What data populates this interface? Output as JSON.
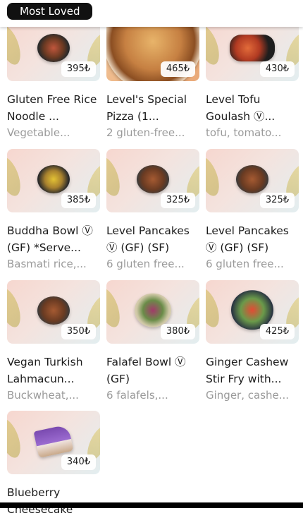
{
  "header": {
    "section_title": "Most Loved"
  },
  "items": [
    {
      "name": "Gluten Free Rice Noodle ...",
      "desc": "Vegetable...",
      "price": "395₺",
      "icon": "noodle-dish"
    },
    {
      "name": "Level's Special Pizza (1...",
      "desc": "2 gluten-free...",
      "price": "465₺",
      "icon": "pizza"
    },
    {
      "name": "Level Tofu Goulash Ⓥ...",
      "desc": "tofu, tomato...",
      "price": "430₺",
      "icon": "sizzling-pan"
    },
    {
      "name": "Buddha Bowl Ⓥ (GF) *Serve...",
      "desc": "Basmati rice,...",
      "price": "385₺",
      "icon": "bowl"
    },
    {
      "name": "Level Pancakes Ⓥ (GF) (SF)",
      "desc": "6 gluten free...",
      "price": "325₺",
      "icon": "pancakes"
    },
    {
      "name": "Level Pancakes Ⓥ (GF) (SF)",
      "desc": "6 gluten free...",
      "price": "325₺",
      "icon": "pancakes"
    },
    {
      "name": "Vegan Turkish Lahmacun...",
      "desc": "Buckwheat,...",
      "price": "350₺",
      "icon": "lahmacun"
    },
    {
      "name": "Falafel Bowl Ⓥ (GF)",
      "desc": "6 falafels,...",
      "price": "380₺",
      "icon": "falafel-bowl"
    },
    {
      "name": "Ginger Cashew Stir Fry with...",
      "desc": "Ginger, cashe...",
      "price": "425₺",
      "icon": "stir-fry"
    },
    {
      "name": "Blueberry Cheesecake",
      "desc": "",
      "price": "340₺",
      "icon": "cheesecake"
    }
  ]
}
